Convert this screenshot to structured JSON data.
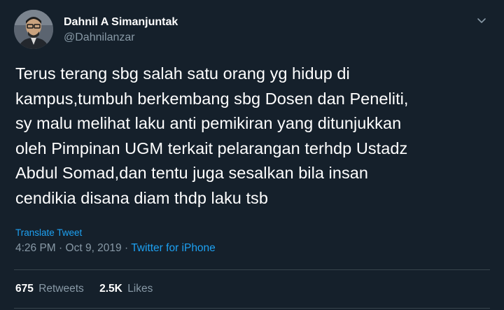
{
  "author": {
    "name": "Dahnil A Simanjuntak",
    "handle": "@Dahnilanzar"
  },
  "tweet": {
    "lines": [
      "Terus terang sbg salah satu orang yg hidup di",
      "kampus,tumbuh berkembang sbg Dosen dan Peneliti,",
      "sy malu melihat laku anti pemikiran yang ditunjukkan",
      "oleh Pimpinan UGM terkait pelarangan terhdp Ustadz",
      "Abdul Somad,dan tentu juga sesalkan bila insan",
      "cendikia disana diam thdp laku tsb"
    ],
    "translate_label": "Translate Tweet",
    "time": "4:26 PM",
    "date": "Oct 9, 2019",
    "separator": "·",
    "source": "Twitter for iPhone"
  },
  "stats": {
    "retweets_count": "675",
    "retweets_label": "Retweets",
    "likes_count": "2.5K",
    "likes_label": "Likes"
  },
  "icons": {
    "menu": "chevron-down-icon",
    "avatar": "avatar"
  },
  "colors": {
    "background": "#15202b",
    "accent": "#1da1f2",
    "secondary_text": "#8899a6",
    "divider": "#38444d"
  }
}
